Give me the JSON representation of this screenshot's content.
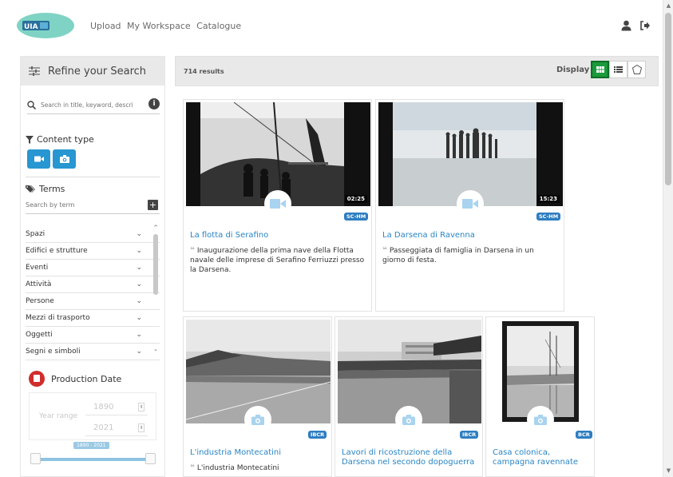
{
  "header": {
    "logo_text": "UIA",
    "nav": [
      "Upload",
      "My Workspace",
      "Catalogue"
    ]
  },
  "sidebar": {
    "refine_title": "Refine your Search",
    "search_placeholder": "Search in title, keyword, descri",
    "content_type_label": "Content type",
    "terms_label": "Terms",
    "term_search_placeholder": "Search by term",
    "terms": [
      "Spazi",
      "Edifici e strutture",
      "Eventi",
      "Attività",
      "Persone",
      "Mezzi di trasporto",
      "Oggetti",
      "Segni e simboli"
    ],
    "production_date_label": "Production Date",
    "year_range_label": "Year range",
    "year_from": "1890",
    "year_to": "2021",
    "range_badge": "1890 - 2021"
  },
  "results": {
    "count": "714 results",
    "display_label": "Display"
  },
  "cards": [
    {
      "title": "La flotta di Serafino",
      "desc": "Inaugurazione della prima nave della Flotta navale delle imprese di Serafino Ferriuzzi presso la Darsena.",
      "duration": "02:25",
      "badge": "SC-HM",
      "type": "video"
    },
    {
      "title": "La Darsena di Ravenna",
      "desc": "Passeggiata di famiglia in Darsena in un giorno di festa.",
      "duration": "15:23",
      "badge": "SC-HM",
      "type": "video"
    },
    {
      "title": "L'industria Montecatini",
      "desc": "L'industria Montecatini",
      "badge": "IBCR",
      "type": "photo"
    },
    {
      "title": "Lavori di ricostruzione della Darsena nel secondo dopoguerra",
      "desc": "",
      "badge": "IBCR",
      "type": "photo"
    },
    {
      "title": "Casa colonica, campagna ravennate",
      "desc": "",
      "badge": "BCR",
      "type": "photo"
    }
  ],
  "colors": {
    "accent": "#2796d1",
    "link": "#2a85c4",
    "active_view": "#1a9a3b",
    "badge": "#2e7ec1"
  }
}
